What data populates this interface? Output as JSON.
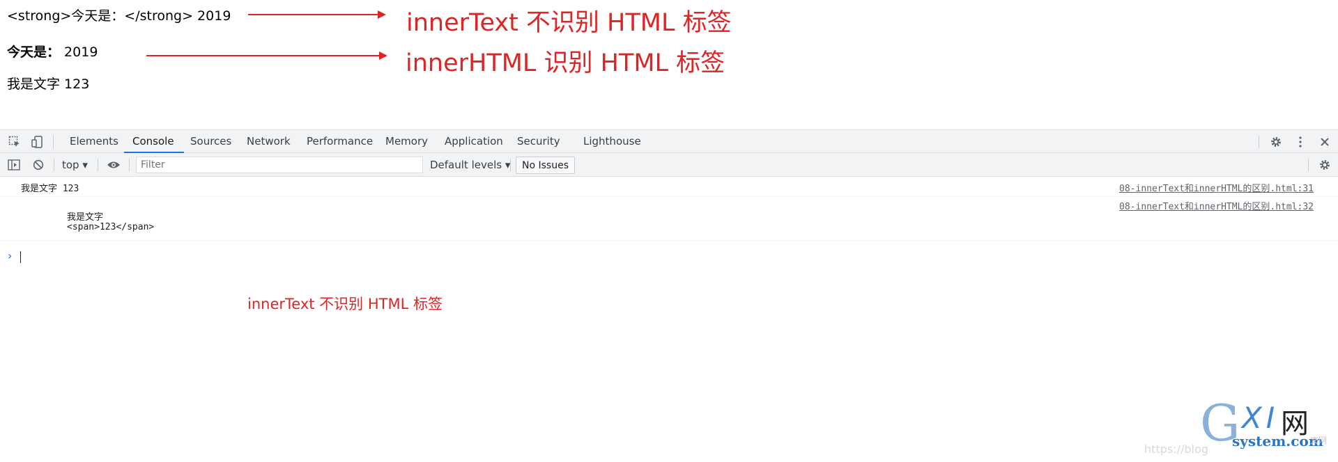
{
  "page": {
    "line1": "<strong>今天是：</strong> 2019",
    "line2_bold": "今天是：",
    "line2_rest": " 2019",
    "line3": "我是文字 123"
  },
  "annotations": {
    "a1": "innerText 不识别 HTML 标签",
    "a2": "innerHTML 识别 HTML 标签",
    "a3": "innerText 不识别 HTML 标签",
    "color": "#e02424"
  },
  "devtools": {
    "tabs": [
      "Elements",
      "Console",
      "Sources",
      "Network",
      "Performance",
      "Memory",
      "Application",
      "Security",
      "Lighthouse"
    ],
    "active_tab": "Console",
    "toolbar": {
      "context": "top",
      "filter_placeholder": "Filter",
      "levels": "Default levels",
      "issues": "No Issues"
    },
    "console": {
      "row1_text": "我是文字 123",
      "row1_source": "08-innerText和innerHTML的区别.html:31",
      "row2_line1": "我是文字",
      "row2_line2": "<span>123</span>",
      "row2_source": "08-innerText和innerHTML的区别.html:32",
      "prompt": "›"
    },
    "accent_color": "#1a73e8"
  },
  "watermark": {
    "url": "https://blog",
    "logo_g": "G",
    "logo_xi": "XI",
    "logo_wang": "网",
    "logo_domain": "system.com",
    "logo_small": "文网"
  }
}
